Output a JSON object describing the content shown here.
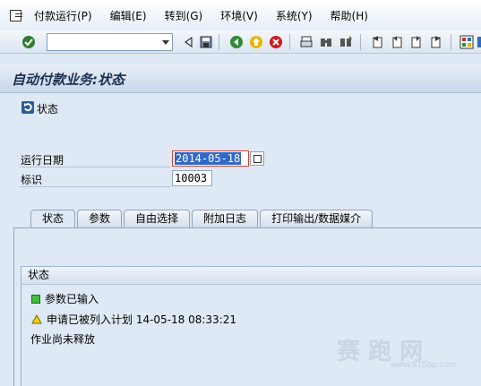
{
  "menu": {
    "items": [
      "付款运行(P)",
      "编辑(E)",
      "转到(G)",
      "环境(V)",
      "系统(Y)",
      "帮助(H)"
    ]
  },
  "toolbar": {
    "command_value": "",
    "icons": [
      "check-icon",
      "back-icon",
      "save-icon",
      "green-back-icon",
      "exit-icon",
      "cancel-icon",
      "print-icon",
      "find-icon",
      "find-next-icon",
      "first-page-icon",
      "prev-page-icon",
      "next-page-icon",
      "last-page-icon",
      "layout-icon"
    ]
  },
  "title": "自动付款业务:状态",
  "app_toolbar": {
    "status_label": "状态"
  },
  "fields": {
    "run_date_label": "运行日期",
    "run_date_value": "2014-05-18",
    "id_label": "标识",
    "id_value": "10003"
  },
  "tabs": [
    "状态",
    "参数",
    "自由选择",
    "附加日志",
    "打印输出/数据媒介"
  ],
  "status_group": {
    "title": "状态",
    "lines": [
      {
        "icon": "green-square-icon",
        "text": "参数已输入"
      },
      {
        "icon": "warning-triangle-icon",
        "text": "申请已被列入计划 14-05-18 08:33:21"
      },
      {
        "icon": "",
        "text": "作业尚未释放"
      }
    ]
  },
  "watermark": {
    "text": "赛 跑 网",
    "url": "www.915ap.com"
  },
  "colors": {
    "background": "#dfe9f5",
    "selection": "#3169c6",
    "accent_red": "#d3402b"
  }
}
